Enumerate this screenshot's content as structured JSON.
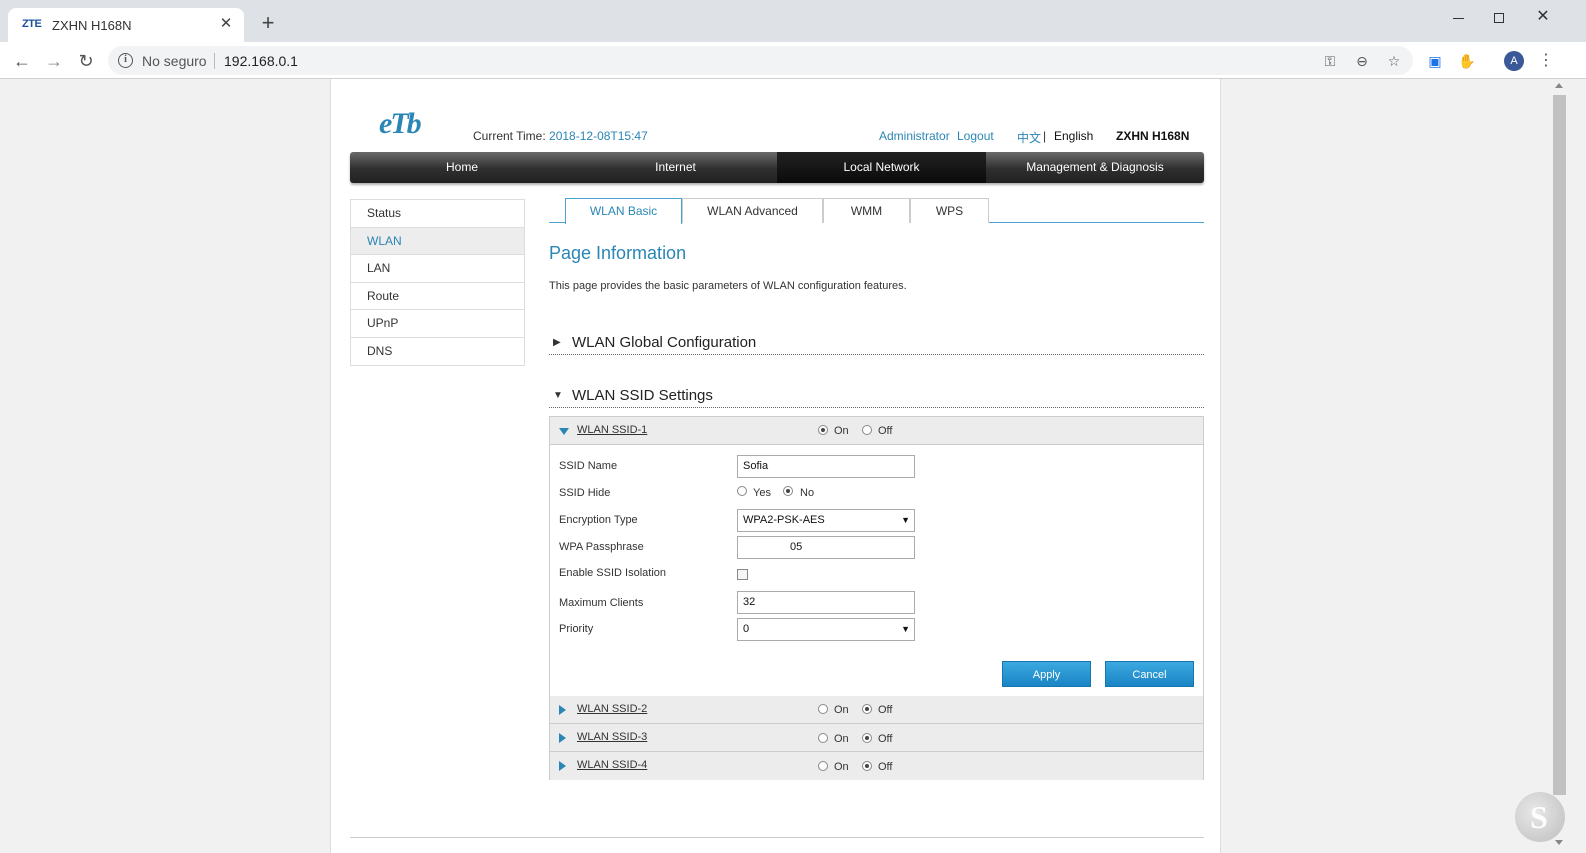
{
  "browser": {
    "tab_favicon": "ZTE",
    "tab_title": "ZXHN H168N",
    "tab_close": "✕",
    "new_tab": "+",
    "not_secure": "No seguro",
    "url": "192.168.0.1",
    "profile_initial": "A"
  },
  "header": {
    "logo": "eTb",
    "current_time_label": "Current Time: ",
    "current_time": "2018-12-08T15:47",
    "admin": "Administrator",
    "logout": "Logout",
    "lang_zh": "中文",
    "lang_sep": "|",
    "lang_en": "English",
    "model": "ZXHN H168N"
  },
  "mainnav": {
    "home": "Home",
    "internet": "Internet",
    "local_network": "Local Network",
    "management": "Management & Diagnosis"
  },
  "sidemenu": {
    "items": [
      "Status",
      "WLAN",
      "LAN",
      "Route",
      "UPnP",
      "DNS"
    ],
    "active": "WLAN"
  },
  "subtabs": {
    "basic": "WLAN Basic",
    "advanced": "WLAN Advanced",
    "wmm": "WMM",
    "wps": "WPS"
  },
  "page_info": {
    "title": "Page Information",
    "desc": "This page provides the basic parameters of WLAN configuration features."
  },
  "sections": {
    "global": "WLAN Global Configuration",
    "ssid": "WLAN SSID Settings"
  },
  "ssid1": {
    "name": "WLAN SSID-1",
    "on": "On",
    "off": "Off",
    "state": "On",
    "form": {
      "ssid_name_label": "SSID Name",
      "ssid_name": "Sofia",
      "ssid_hide_label": "SSID Hide",
      "yes": "Yes",
      "no": "No",
      "ssid_hide": "No",
      "encryption_label": "Encryption Type",
      "encryption": "WPA2-PSK-AES",
      "passphrase_label": "WPA Passphrase",
      "passphrase": "05",
      "isolation_label": "Enable SSID Isolation",
      "isolation": false,
      "max_clients_label": "Maximum Clients",
      "max_clients": "32",
      "priority_label": "Priority",
      "priority": "0",
      "apply": "Apply",
      "cancel": "Cancel"
    }
  },
  "ssid_others": [
    {
      "name": "WLAN SSID-2",
      "on": "On",
      "off": "Off",
      "state": "Off"
    },
    {
      "name": "WLAN SSID-3",
      "on": "On",
      "off": "Off",
      "state": "Off"
    },
    {
      "name": "WLAN SSID-4",
      "on": "On",
      "off": "Off",
      "state": "Off"
    }
  ],
  "colors": {
    "accent": "#2a86b4",
    "button": "#1a84c4",
    "nav_dark": "#2e2e2e"
  }
}
